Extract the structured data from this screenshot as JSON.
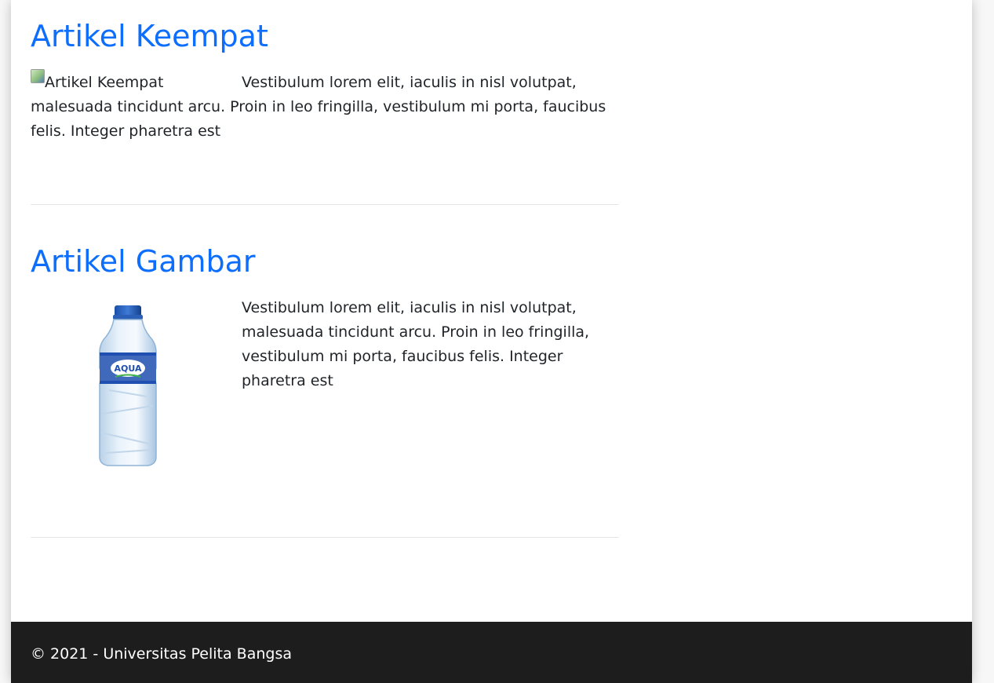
{
  "articles": [
    {
      "title": "Artikel Keempat",
      "image_alt": "Artikel Keempat",
      "image_broken": true,
      "body": "Vestibulum lorem elit, iaculis in nisl volutpat, malesuada tincidunt arcu. Proin in leo fringilla, vestibulum mi porta, faucibus felis. Integer pharetra est"
    },
    {
      "title": "Artikel Gambar",
      "image": "water-bottle-aqua",
      "image_label": "AQUA",
      "body": "Vestibulum lorem elit, iaculis in nisl volutpat, malesuada tincidunt arcu. Proin in leo fringilla, vestibulum mi porta, faucibus felis. Integer pharetra est"
    }
  ],
  "footer": {
    "text": "© 2021 - Universitas Pelita Bangsa"
  },
  "colors": {
    "link": "#0d6efd",
    "text": "#212529",
    "footer_bg": "#1d1d1d",
    "footer_text": "#ffffff",
    "brand_blue": "#1f4fb0"
  }
}
